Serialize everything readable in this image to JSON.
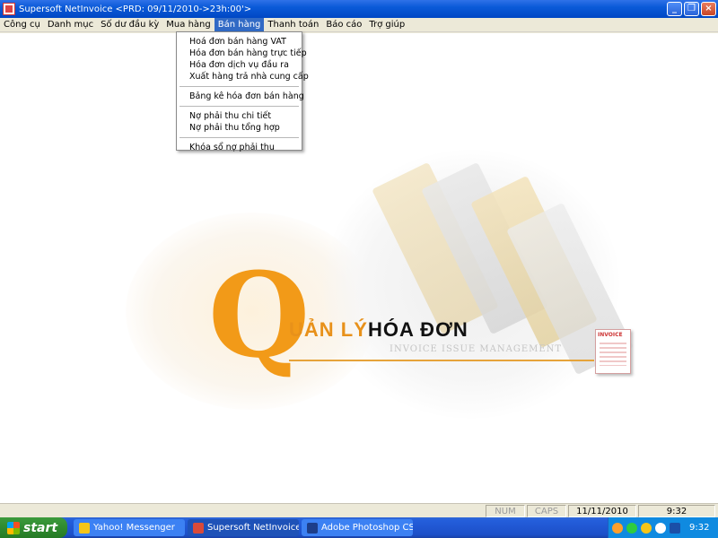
{
  "window": {
    "title": "Supersoft NetInvoice <PRD: 09/11/2010->23h:00'>",
    "minimize_label": "_",
    "restore_label": "❐",
    "close_label": "×"
  },
  "menu": {
    "items": [
      "Công cụ",
      "Danh mục",
      "Số dư đầu kỳ",
      "Mua hàng",
      "Bán hàng",
      "Thanh toán",
      "Báo cáo",
      "Trợ giúp"
    ],
    "active": "Bán hàng"
  },
  "dropdown": {
    "group1": [
      "Hoá đơn bán hàng VAT",
      "Hóa đơn bán hàng  trực tiếp",
      "Hóa đơn dịch vụ đầu ra",
      "Xuất hàng trả nhà cung cấp"
    ],
    "group2": [
      "Bảng kê hóa đơn bán hàng"
    ],
    "group3": [
      "Nợ phải thu chi tiết",
      "Nợ phải thu tổng hợp"
    ],
    "group4": [
      "Khóa sổ nợ phải thu"
    ]
  },
  "splash": {
    "letter": "Q",
    "word1": "UẢN LÝ",
    "word2": "HÓA ĐƠN",
    "subtitle": "INVOICE ISSUE MANAGEMENT",
    "doc_label": "INVOICE",
    "accent": "#f29a18"
  },
  "statusbar": {
    "num": "NUM",
    "caps": "CAPS",
    "date": "11/11/2010",
    "time": "9:32"
  },
  "taskbar": {
    "start": "start",
    "tasks": [
      "Yahoo! Messenger",
      "Supersoft NetInvoice...",
      "Adobe Photoshop CS..."
    ],
    "clock": "9:32"
  }
}
